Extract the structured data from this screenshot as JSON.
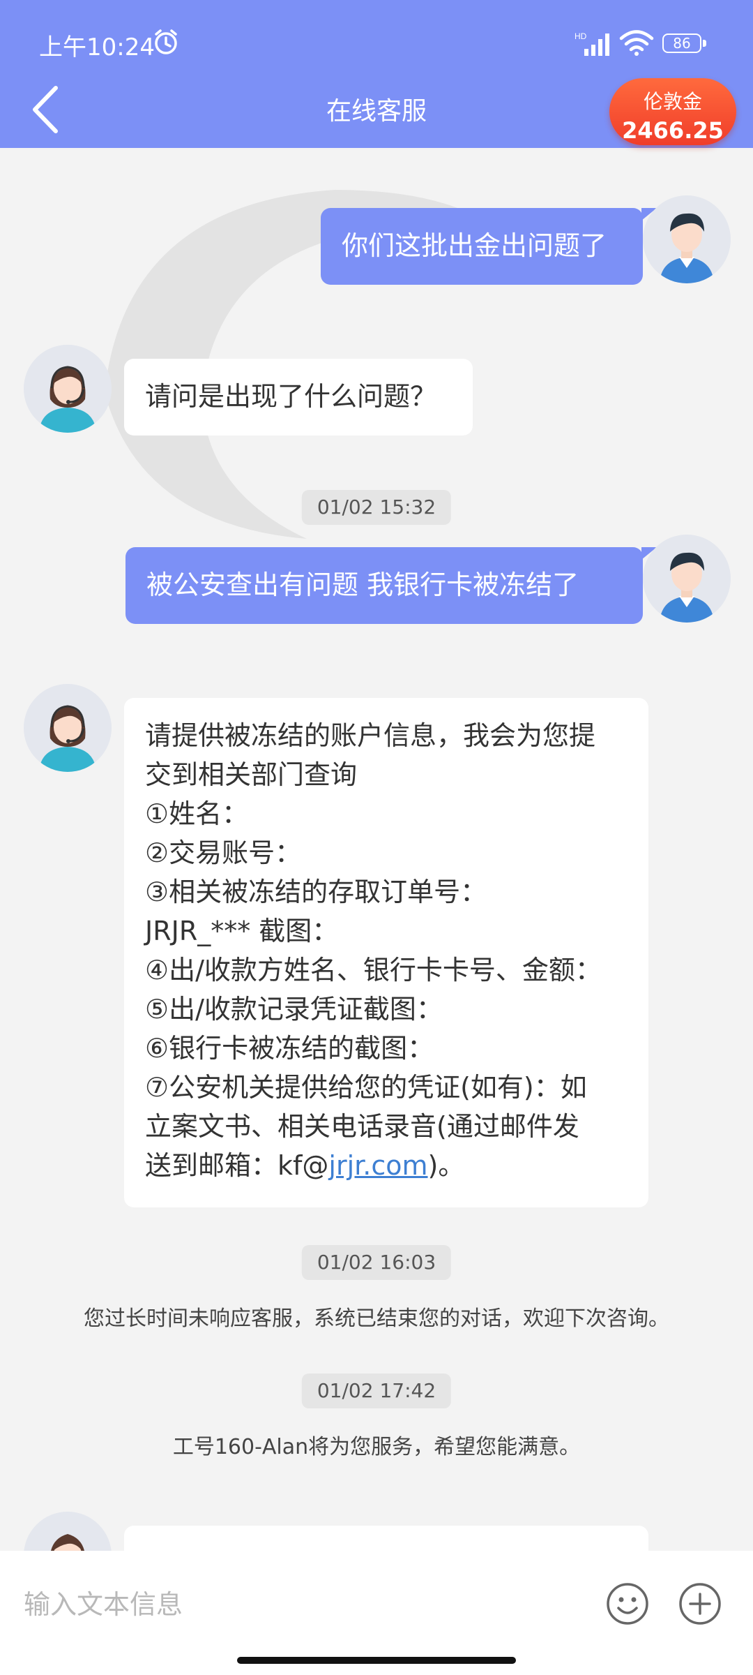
{
  "status_bar": {
    "time": "上午10:24",
    "battery": "86",
    "signal_label": "HD"
  },
  "header": {
    "title": "在线客服",
    "coin_label": "伦敦金",
    "coin_value": "2466.25"
  },
  "messages": [
    {
      "sender": "user",
      "text": "你们这批出金出问题了"
    },
    {
      "sender": "agent",
      "text": "请问是出现了什么问题？"
    },
    {
      "type": "time",
      "text": "01/02 15:32"
    },
    {
      "sender": "user",
      "text": "被公安查出有问题 我银行卡被冻结了"
    },
    {
      "sender": "agent",
      "lines": [
        "请提供被冻结的账户信息，我会为您提",
        "交到相关部门查询",
        "①姓名：",
        "②交易账号：",
        "③相关被冻结的存取订单号：",
        "JRJR_*** 截图：",
        "④出/收款方姓名、银行卡卡号、金额：",
        "⑤出/收款记录凭证截图：",
        "⑥银行卡被冻结的截图：",
        "⑦公安机关提供给您的凭证(如有)：如",
        "立案文书、相关电话录音(通过邮件发",
        "送到邮箱：kf@"
      ],
      "email_link": "jrjr.com",
      "tail": ")。"
    },
    {
      "type": "time",
      "text": "01/02 16:03"
    },
    {
      "type": "system",
      "text": "您过长时间未响应客服，系统已结束您的对话，欢迎下次咨询。"
    },
    {
      "type": "time",
      "text": "01/02 17:42"
    },
    {
      "type": "system",
      "text": "工号160-Alan将为您服务，希望您能满意。"
    }
  ],
  "input": {
    "placeholder": "输入文本信息"
  },
  "icons": {
    "back": "chevron-left-icon",
    "emoji": "smiley-icon",
    "plus": "plus-circle-icon",
    "user_avatar": "male-user-avatar",
    "agent_avatar": "female-agent-headset-avatar"
  },
  "colors": {
    "accent": "#7c90f6",
    "badge": "#f03d2a",
    "link": "#3d7fd2"
  }
}
